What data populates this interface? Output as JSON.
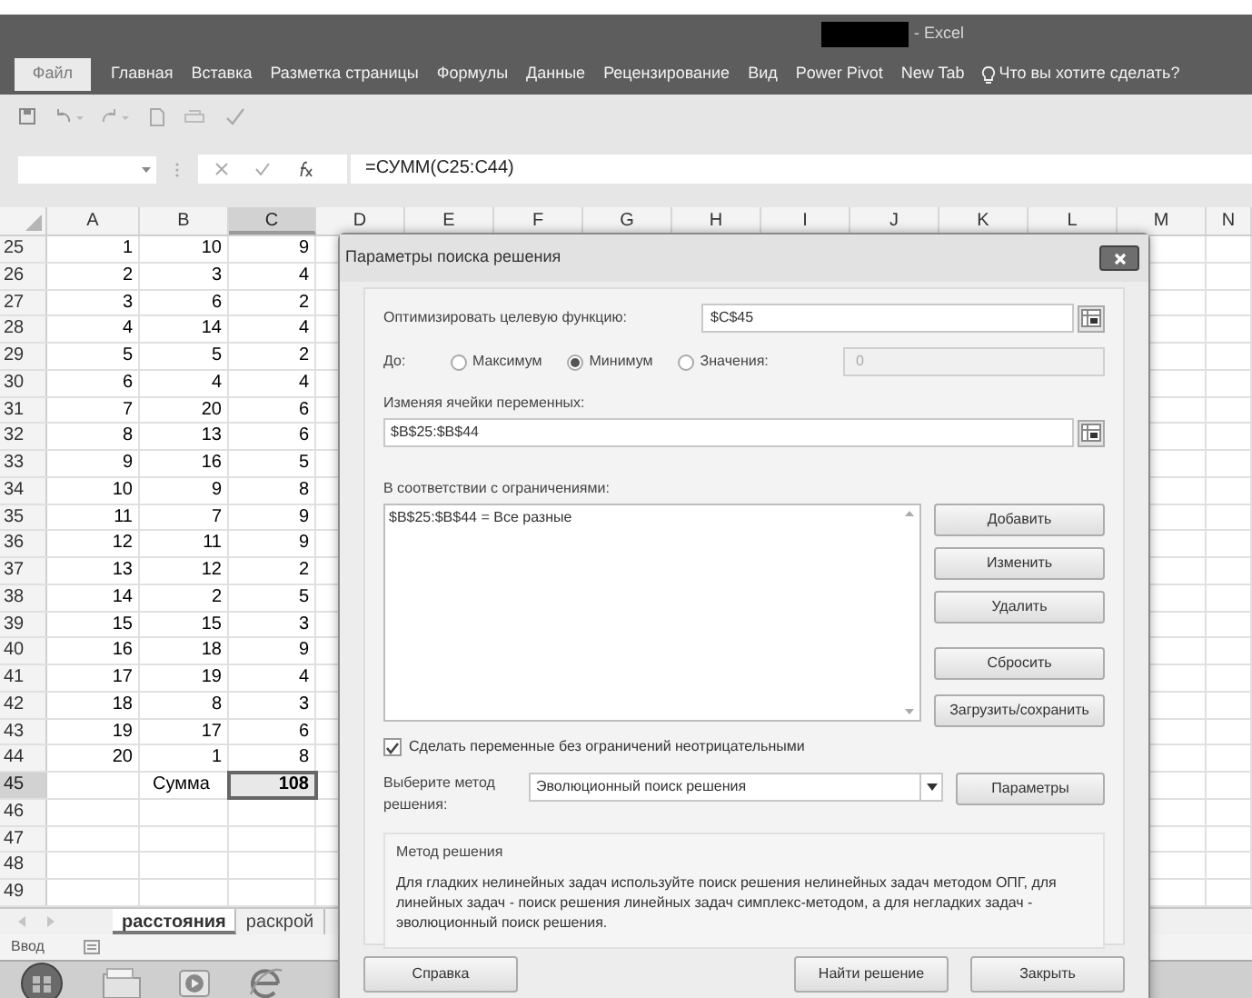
{
  "window": {
    "title_suffix": "- Excel"
  },
  "ribbon_tabs": [
    {
      "label": "Файл",
      "kind": "file"
    },
    {
      "label": "Главная",
      "kind": "tab"
    },
    {
      "label": "Вставка",
      "kind": "tab"
    },
    {
      "label": "Разметка страницы",
      "kind": "tab"
    },
    {
      "label": "Формулы",
      "kind": "tab"
    },
    {
      "label": "Данные",
      "kind": "tab"
    },
    {
      "label": "Рецензирование",
      "kind": "tab"
    },
    {
      "label": "Вид",
      "kind": "tab"
    },
    {
      "label": "Power Pivot",
      "kind": "tab"
    },
    {
      "label": "New Tab",
      "kind": "tab"
    }
  ],
  "tell_me": "Что вы хотите сделать?",
  "formula_bar": {
    "formula": "=СУММ(C25:C44)"
  },
  "columns": [
    {
      "label": "A",
      "selected": false
    },
    {
      "label": "B",
      "selected": false
    },
    {
      "label": "C",
      "selected": true
    },
    {
      "label": "D",
      "selected": false
    },
    {
      "label": "E",
      "selected": false
    },
    {
      "label": "F",
      "selected": false
    },
    {
      "label": "G",
      "selected": false
    },
    {
      "label": "H",
      "selected": false
    },
    {
      "label": "I",
      "selected": false
    },
    {
      "label": "J",
      "selected": false
    },
    {
      "label": "K",
      "selected": false
    },
    {
      "label": "L",
      "selected": false
    },
    {
      "label": "M",
      "selected": false
    },
    {
      "label": "N",
      "selected": false
    }
  ],
  "rows": [
    {
      "number": "25",
      "a": "1",
      "b": "10",
      "c": "9",
      "selected": false
    },
    {
      "number": "26",
      "a": "2",
      "b": "3",
      "c": "4",
      "selected": false
    },
    {
      "number": "27",
      "a": "3",
      "b": "6",
      "c": "2",
      "selected": false
    },
    {
      "number": "28",
      "a": "4",
      "b": "14",
      "c": "4",
      "selected": false
    },
    {
      "number": "29",
      "a": "5",
      "b": "5",
      "c": "2",
      "selected": false
    },
    {
      "number": "30",
      "a": "6",
      "b": "4",
      "c": "4",
      "selected": false
    },
    {
      "number": "31",
      "a": "7",
      "b": "20",
      "c": "6",
      "selected": false
    },
    {
      "number": "32",
      "a": "8",
      "b": "13",
      "c": "6",
      "selected": false
    },
    {
      "number": "33",
      "a": "9",
      "b": "16",
      "c": "5",
      "selected": false
    },
    {
      "number": "34",
      "a": "10",
      "b": "9",
      "c": "8",
      "selected": false
    },
    {
      "number": "35",
      "a": "11",
      "b": "7",
      "c": "9",
      "selected": false
    },
    {
      "number": "36",
      "a": "12",
      "b": "11",
      "c": "9",
      "selected": false
    },
    {
      "number": "37",
      "a": "13",
      "b": "12",
      "c": "2",
      "selected": false
    },
    {
      "number": "38",
      "a": "14",
      "b": "2",
      "c": "5",
      "selected": false
    },
    {
      "number": "39",
      "a": "15",
      "b": "15",
      "c": "3",
      "selected": false
    },
    {
      "number": "40",
      "a": "16",
      "b": "18",
      "c": "9",
      "selected": false
    },
    {
      "number": "41",
      "a": "17",
      "b": "19",
      "c": "4",
      "selected": false
    },
    {
      "number": "42",
      "a": "18",
      "b": "8",
      "c": "3",
      "selected": false
    },
    {
      "number": "43",
      "a": "19",
      "b": "17",
      "c": "6",
      "selected": false
    },
    {
      "number": "44",
      "a": "20",
      "b": "1",
      "c": "8",
      "selected": false
    },
    {
      "number": "45",
      "b": "Сумма",
      "c": "108",
      "selected": true
    },
    {
      "number": "46",
      "selected": false
    },
    {
      "number": "47",
      "selected": false
    },
    {
      "number": "48",
      "selected": false
    },
    {
      "number": "49",
      "selected": false
    }
  ],
  "sheet_tabs": [
    {
      "label": "расстояния",
      "selected": true
    },
    {
      "label": "раскрой",
      "selected": false
    }
  ],
  "status_bar": {
    "mode": "Ввод"
  },
  "dialog": {
    "title": "Параметры поиска решения",
    "objective_label": "Оптимизировать целевую функцию:",
    "objective_value": "$C$45",
    "to_label": "До:",
    "options": [
      {
        "label": "Максимум",
        "selected": false
      },
      {
        "label": "Минимум",
        "selected": true
      },
      {
        "label": "Значения:",
        "selected": false
      }
    ],
    "value_field": {
      "value": "0",
      "disabled": true
    },
    "changing_label": "Изменяя ячейки переменных:",
    "changing_value": "$B$25:$B$44",
    "constraints_label": "В соответствии с ограничениями:",
    "constraints": [
      "$B$25:$B$44 = Все разные"
    ],
    "side_buttons": [
      "Добавить",
      "Изменить",
      "Удалить",
      "Сбросить",
      "Загрузить/сохранить"
    ],
    "nonnegative": {
      "label": "Сделать переменные без ограничений неотрицательными",
      "checked": true
    },
    "method_label": "Выберите метод решения:",
    "method_value": "Эволюционный поиск решения",
    "parameters_button": "Параметры",
    "method_group_title": "Метод решения",
    "method_description": "Для гладких нелинейных задач используйте поиск решения нелинейных задач методом ОПГ, для линейных задач - поиск решения линейных задач симплекс-методом, а для негладких задач - эволюционный поиск решения.",
    "footer_buttons": [
      "Справка",
      "Найти решение",
      "Закрыть"
    ]
  }
}
